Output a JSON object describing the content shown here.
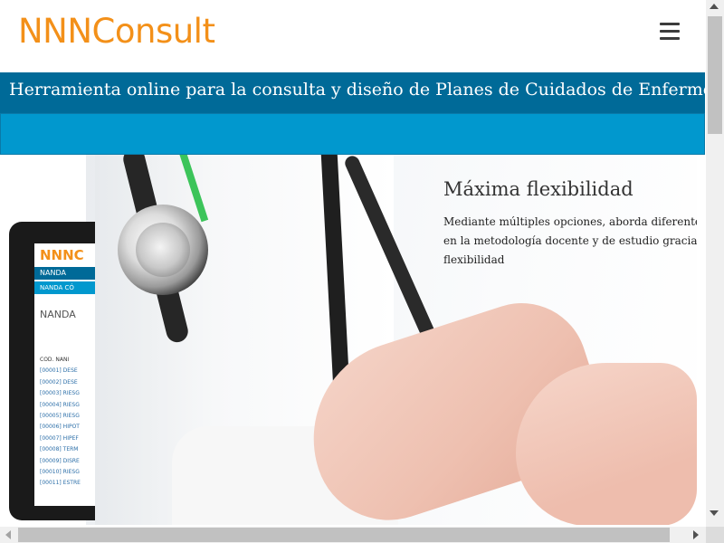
{
  "header": {
    "logo_text": "NNNConsult",
    "menu_icon": "hamburger-menu-icon"
  },
  "banner": {
    "title": "Herramienta online para la consulta y diseño de Planes de Cuidados de Enfermería."
  },
  "slide": {
    "title": "Máxima flexibilidad",
    "text": "Mediante múltiples opciones, aborda diferentes en la metodología docente y de estudio gracias a flexibilidad"
  },
  "tablet": {
    "logo": "NNNC",
    "nav1": "NANDA",
    "nav2": "NANDA   CÓ",
    "heading": "NANDA",
    "col_header": "COD.  NANI",
    "rows": [
      "[00001]  DESE",
      "[00002]  DESE",
      "[00003]  RIESG",
      "[00004]  RIESG",
      "[00005]  RIESG",
      "[00006]  HIPOT",
      "[00007]  HIPEF",
      "[00008]  TERM",
      "[00009]  DISRE",
      "[00010]  RIESG",
      "[00011]  ESTRE"
    ]
  },
  "colors": {
    "logo": "#f39019",
    "title_bar": "#006a98",
    "sub_bar": "#0198ce"
  }
}
